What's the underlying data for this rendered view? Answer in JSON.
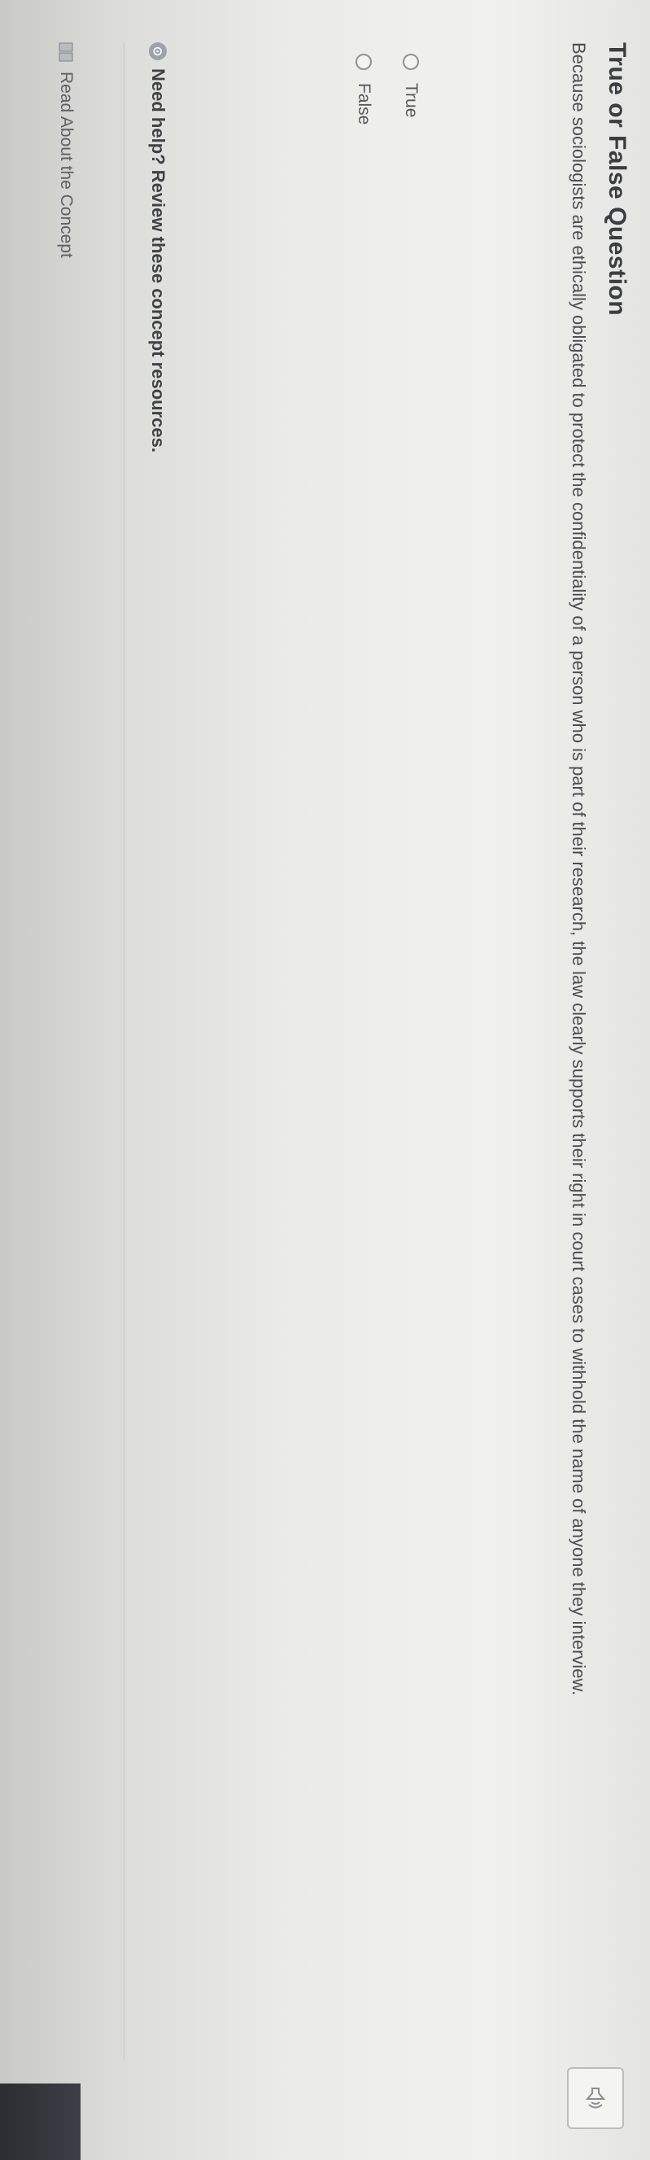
{
  "question": {
    "heading": "True or False Question",
    "text": "Because sociologists are ethically obligated to protect the confidentiality of a person who is part of their research, the law clearly supports their right in court cases to withhold the name of anyone they interview.",
    "options": [
      {
        "label": "True",
        "selected": false
      },
      {
        "label": "False",
        "selected": false
      }
    ],
    "audio_icon": "speaker-icon"
  },
  "help": {
    "icon": "help-circle-icon",
    "text": "Need help? Review these concept resources."
  },
  "resources": {
    "icon": "book-icon",
    "link_label": "Read About the Concept"
  }
}
